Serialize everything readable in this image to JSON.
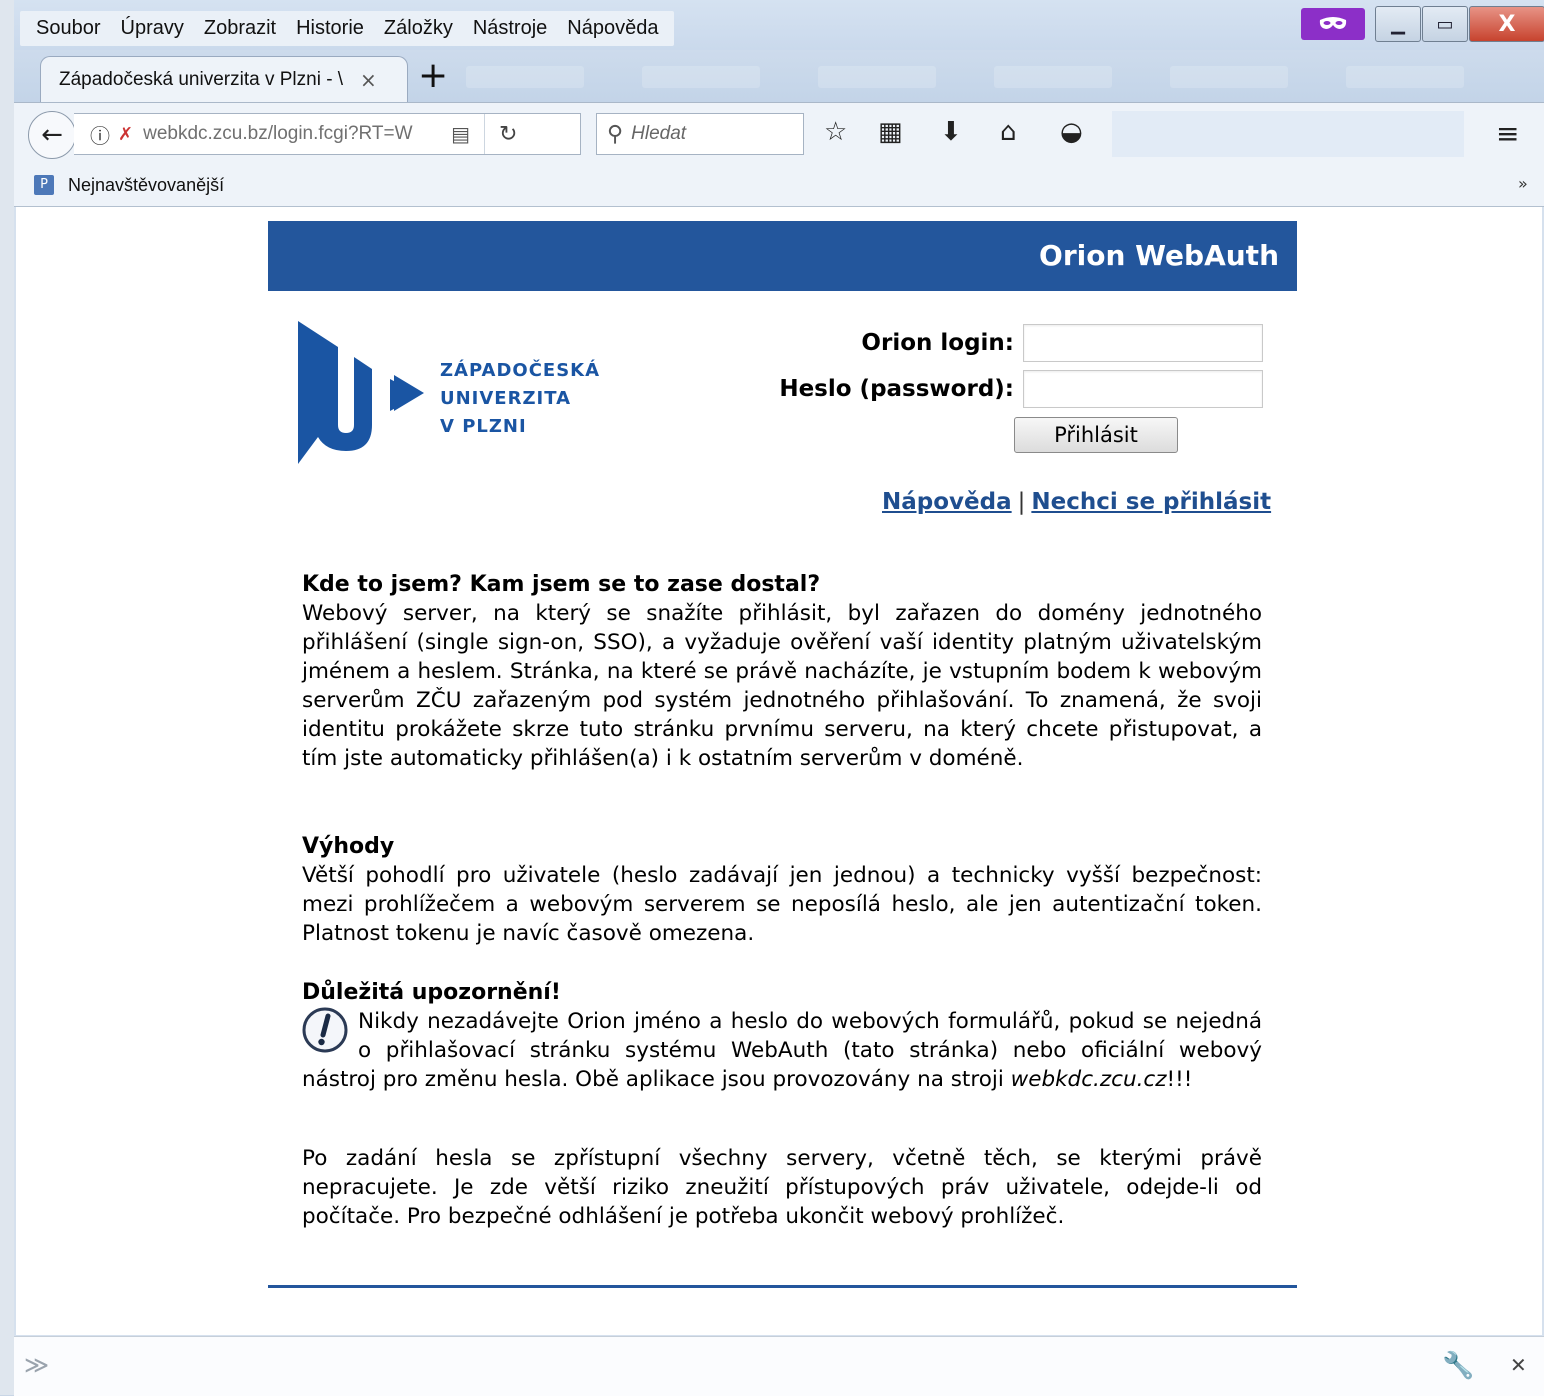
{
  "browser": {
    "menu": [
      "Soubor",
      "Úpravy",
      "Zobrazit",
      "Historie",
      "Záložky",
      "Nástroje",
      "Nápověda"
    ],
    "tab_title": "Západočeská univerzita v Plzni - \\",
    "tab_close": "×",
    "new_tab": "+",
    "url": "webkdc.zcu.bz/login.fcgi?RT=W",
    "search_placeholder": "Hledat",
    "bookmark_label": "Nejnavštěvovanější",
    "bookmark_more": "»"
  },
  "page": {
    "banner_title": "Orion WebAuth",
    "logo_lines": [
      "ZÁPADOČESKÁ",
      "UNIVERZITA",
      "V PLZNI"
    ],
    "login_label": "Orion login:",
    "password_label": "Heslo (password):",
    "submit_label": "Přihlásit",
    "help_link": "Nápověda",
    "link_separator": "|",
    "cancel_link": "Nechci se přihlásit",
    "section1_heading": "Kde to jsem? Kam jsem se to zase dostal?",
    "section1_text": "Webový server, na který se snažíte přihlásit, byl zařazen do domény jednotného přihlášení (single sign-on, SSO), a vyžaduje ověření vaší identity platným uživatelským jménem a heslem. Stránka, na které se právě nacházíte, je vstupním bodem k webovým serverům ZČU zařazeným pod systém jednotného přihlašování. To znamená, že svoji identitu prokážete skrze tuto stránku prvnímu serveru, na který chcete přistupovat, a tím jste automaticky přihlášen(a) i k ostatním serverům v doméně.",
    "section2_heading": "Výhody",
    "section2_text": "Větší pohodlí pro uživatele (heslo zadávají jen jednou) a technicky vyšší bezpečnost: mezi prohlížečem a webovým serverem se neposílá heslo, ale jen autentizační token. Platnost tokenu je navíc časově omezena.",
    "section3_heading": "Důležitá upozornění!",
    "section3_text_a": "Nikdy nezadávejte Orion jméno a heslo do webových formulářů, pokud se nejedná o přihlašovací stránku systému WebAuth (tato stránka) nebo oficiální webový nástroj pro změnu hesla. Obě aplikace jsou provozovány na stroji ",
    "section3_host": "webkdc.zcu.cz",
    "section3_text_b": "!!!",
    "section4_text": "Po zadání hesla se zpřístupní všechny servery, včetně těch, se kterými právě nepracujete. Je zde větší riziko zneužití přístupových práv uživatele, odejde-li od počítače. Pro bezpečné odhlášení je potřeba ukončit webový prohlížeč."
  },
  "colors": {
    "banner": "#23569c",
    "link": "#1f4e8f",
    "logo": "#1a55a3"
  }
}
